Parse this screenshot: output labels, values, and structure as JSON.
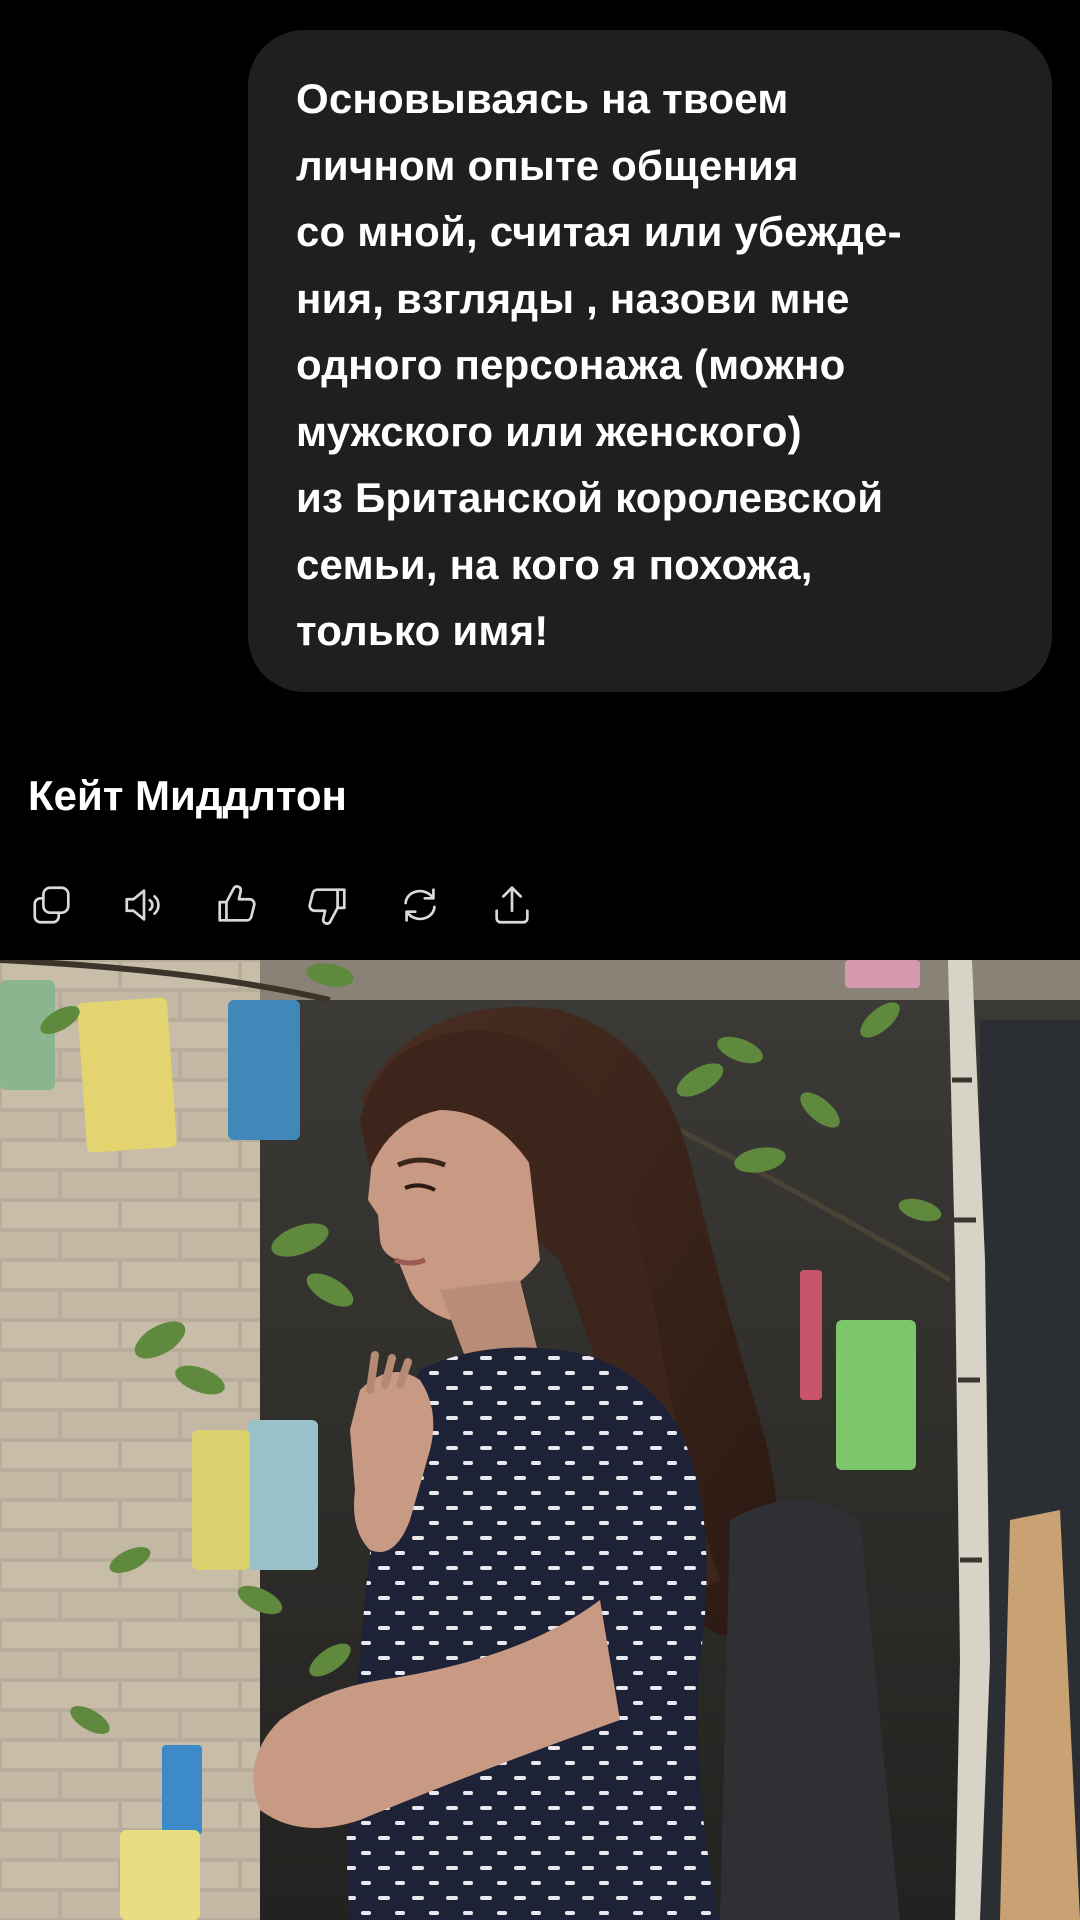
{
  "user_message": {
    "lines": [
      "Основываясь на твоем",
      "личном опыте общения",
      "со мной, считая или убежде-",
      "ния, взгляды , назови мне",
      "одного персонажа (можно",
      "мужского или женского)",
      "из Британской королевской",
      "семьи, на кого я похожа,",
      "только имя!"
    ]
  },
  "assistant_message": {
    "text": "Кейт Миддлтон"
  },
  "actions": [
    {
      "icon": "copy-icon"
    },
    {
      "icon": "speaker-icon"
    },
    {
      "icon": "thumbs-up-icon"
    },
    {
      "icon": "thumbs-down-icon"
    },
    {
      "icon": "regenerate-icon"
    },
    {
      "icon": "share-icon"
    }
  ],
  "colors": {
    "background": "#000000",
    "bubble": "#1f1f1f",
    "text": "#ffffff",
    "icon": "#d9d9d9"
  }
}
